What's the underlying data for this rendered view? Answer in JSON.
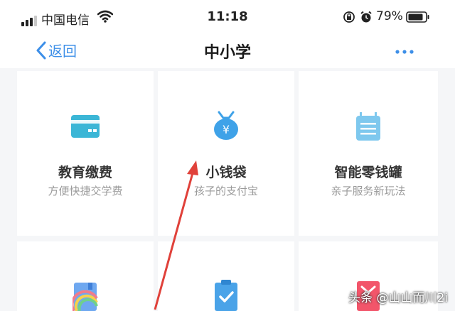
{
  "status_bar": {
    "carrier": "中国电信",
    "time": "11:18",
    "battery": "79%"
  },
  "nav": {
    "back_label": "返回",
    "title": "中小学",
    "accent": "#3d8fe8"
  },
  "tiles": [
    {
      "title": "教育缴费",
      "subtitle": "方便快捷交学费",
      "icon": "card-icon"
    },
    {
      "title": "小钱袋",
      "subtitle": "孩子的支付宝",
      "icon": "money-bag-icon"
    },
    {
      "title": "智能零钱罐",
      "subtitle": "亲子服务新玩法",
      "icon": "piggy-jar-icon"
    },
    {
      "title": "",
      "subtitle": "",
      "icon": "rainbow-book-icon"
    },
    {
      "title": "",
      "subtitle": "",
      "icon": "clipboard-check-icon"
    },
    {
      "title": "",
      "subtitle": "",
      "icon": "red-bag-icon"
    }
  ],
  "watermark": "头条 @山山而川2i"
}
